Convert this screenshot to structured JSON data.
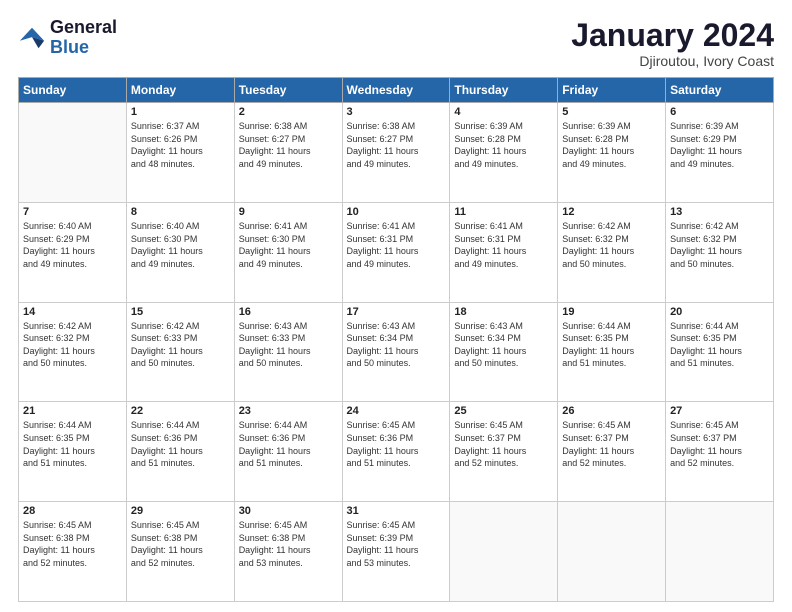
{
  "header": {
    "logo_line1": "General",
    "logo_line2": "Blue",
    "title": "January 2024",
    "location": "Djiroutou, Ivory Coast"
  },
  "days_of_week": [
    "Sunday",
    "Monday",
    "Tuesday",
    "Wednesday",
    "Thursday",
    "Friday",
    "Saturday"
  ],
  "weeks": [
    [
      {
        "day": "",
        "info": ""
      },
      {
        "day": "1",
        "info": "Sunrise: 6:37 AM\nSunset: 6:26 PM\nDaylight: 11 hours\nand 48 minutes."
      },
      {
        "day": "2",
        "info": "Sunrise: 6:38 AM\nSunset: 6:27 PM\nDaylight: 11 hours\nand 49 minutes."
      },
      {
        "day": "3",
        "info": "Sunrise: 6:38 AM\nSunset: 6:27 PM\nDaylight: 11 hours\nand 49 minutes."
      },
      {
        "day": "4",
        "info": "Sunrise: 6:39 AM\nSunset: 6:28 PM\nDaylight: 11 hours\nand 49 minutes."
      },
      {
        "day": "5",
        "info": "Sunrise: 6:39 AM\nSunset: 6:28 PM\nDaylight: 11 hours\nand 49 minutes."
      },
      {
        "day": "6",
        "info": "Sunrise: 6:39 AM\nSunset: 6:29 PM\nDaylight: 11 hours\nand 49 minutes."
      }
    ],
    [
      {
        "day": "7",
        "info": "Sunrise: 6:40 AM\nSunset: 6:29 PM\nDaylight: 11 hours\nand 49 minutes."
      },
      {
        "day": "8",
        "info": "Sunrise: 6:40 AM\nSunset: 6:30 PM\nDaylight: 11 hours\nand 49 minutes."
      },
      {
        "day": "9",
        "info": "Sunrise: 6:41 AM\nSunset: 6:30 PM\nDaylight: 11 hours\nand 49 minutes."
      },
      {
        "day": "10",
        "info": "Sunrise: 6:41 AM\nSunset: 6:31 PM\nDaylight: 11 hours\nand 49 minutes."
      },
      {
        "day": "11",
        "info": "Sunrise: 6:41 AM\nSunset: 6:31 PM\nDaylight: 11 hours\nand 49 minutes."
      },
      {
        "day": "12",
        "info": "Sunrise: 6:42 AM\nSunset: 6:32 PM\nDaylight: 11 hours\nand 50 minutes."
      },
      {
        "day": "13",
        "info": "Sunrise: 6:42 AM\nSunset: 6:32 PM\nDaylight: 11 hours\nand 50 minutes."
      }
    ],
    [
      {
        "day": "14",
        "info": "Sunrise: 6:42 AM\nSunset: 6:32 PM\nDaylight: 11 hours\nand 50 minutes."
      },
      {
        "day": "15",
        "info": "Sunrise: 6:42 AM\nSunset: 6:33 PM\nDaylight: 11 hours\nand 50 minutes."
      },
      {
        "day": "16",
        "info": "Sunrise: 6:43 AM\nSunset: 6:33 PM\nDaylight: 11 hours\nand 50 minutes."
      },
      {
        "day": "17",
        "info": "Sunrise: 6:43 AM\nSunset: 6:34 PM\nDaylight: 11 hours\nand 50 minutes."
      },
      {
        "day": "18",
        "info": "Sunrise: 6:43 AM\nSunset: 6:34 PM\nDaylight: 11 hours\nand 50 minutes."
      },
      {
        "day": "19",
        "info": "Sunrise: 6:44 AM\nSunset: 6:35 PM\nDaylight: 11 hours\nand 51 minutes."
      },
      {
        "day": "20",
        "info": "Sunrise: 6:44 AM\nSunset: 6:35 PM\nDaylight: 11 hours\nand 51 minutes."
      }
    ],
    [
      {
        "day": "21",
        "info": "Sunrise: 6:44 AM\nSunset: 6:35 PM\nDaylight: 11 hours\nand 51 minutes."
      },
      {
        "day": "22",
        "info": "Sunrise: 6:44 AM\nSunset: 6:36 PM\nDaylight: 11 hours\nand 51 minutes."
      },
      {
        "day": "23",
        "info": "Sunrise: 6:44 AM\nSunset: 6:36 PM\nDaylight: 11 hours\nand 51 minutes."
      },
      {
        "day": "24",
        "info": "Sunrise: 6:45 AM\nSunset: 6:36 PM\nDaylight: 11 hours\nand 51 minutes."
      },
      {
        "day": "25",
        "info": "Sunrise: 6:45 AM\nSunset: 6:37 PM\nDaylight: 11 hours\nand 52 minutes."
      },
      {
        "day": "26",
        "info": "Sunrise: 6:45 AM\nSunset: 6:37 PM\nDaylight: 11 hours\nand 52 minutes."
      },
      {
        "day": "27",
        "info": "Sunrise: 6:45 AM\nSunset: 6:37 PM\nDaylight: 11 hours\nand 52 minutes."
      }
    ],
    [
      {
        "day": "28",
        "info": "Sunrise: 6:45 AM\nSunset: 6:38 PM\nDaylight: 11 hours\nand 52 minutes."
      },
      {
        "day": "29",
        "info": "Sunrise: 6:45 AM\nSunset: 6:38 PM\nDaylight: 11 hours\nand 52 minutes."
      },
      {
        "day": "30",
        "info": "Sunrise: 6:45 AM\nSunset: 6:38 PM\nDaylight: 11 hours\nand 53 minutes."
      },
      {
        "day": "31",
        "info": "Sunrise: 6:45 AM\nSunset: 6:39 PM\nDaylight: 11 hours\nand 53 minutes."
      },
      {
        "day": "",
        "info": ""
      },
      {
        "day": "",
        "info": ""
      },
      {
        "day": "",
        "info": ""
      }
    ]
  ]
}
